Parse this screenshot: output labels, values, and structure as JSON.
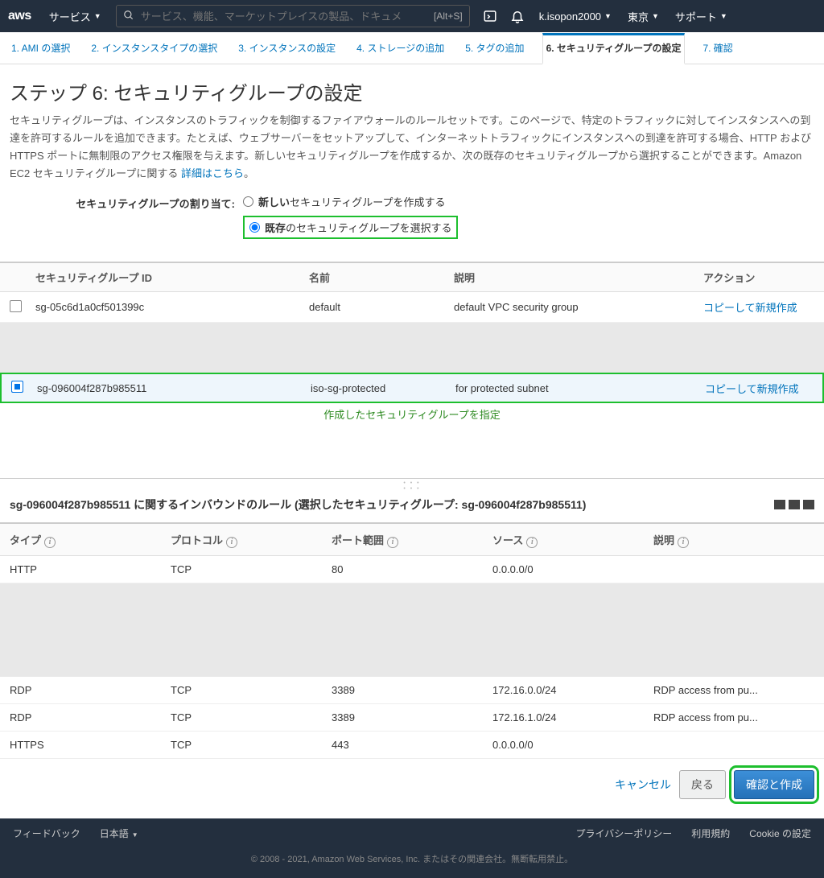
{
  "nav": {
    "services": "サービス",
    "search_placeholder": "サービス、機能、マーケットプレイスの製品、ドキュメ",
    "search_hint": "[Alt+S]",
    "user": "k.isopon2000",
    "region": "東京",
    "support": "サポート"
  },
  "wizard": {
    "tabs": [
      "1. AMI の選択",
      "2. インスタンスタイプの選択",
      "3. インスタンスの設定",
      "4. ストレージの追加",
      "5. タグの追加",
      "6. セキュリティグループの設定",
      "7. 確認"
    ]
  },
  "page": {
    "title": "ステップ 6: セキュリティグループの設定",
    "desc": "セキュリティグループは、インスタンスのトラフィックを制御するファイアウォールのルールセットです。このページで、特定のトラフィックに対してインスタンスへの到達を許可するルールを追加できます。たとえば、ウェブサーバーをセットアップして、インターネットトラフィックにインスタンスへの到達を許可する場合、HTTP および HTTPS ポートに無制限のアクセス権限を与えます。新しいセキュリティグループを作成するか、次の既存のセキュリティグループから選択することができます。Amazon EC2 セキュリティグループに関する ",
    "desc_link": "詳細はこちら",
    "assign_label": "セキュリティグループの割り当て:",
    "opt_new_bold": "新しい",
    "opt_new_rest": "セキュリティグループを作成する",
    "opt_exist_bold": "既存",
    "opt_exist_rest": "のセキュリティグループを選択する"
  },
  "sg_table": {
    "headers": {
      "id": "セキュリティグループ ID",
      "name": "名前",
      "desc": "説明",
      "action": "アクション"
    },
    "rows": [
      {
        "id": "sg-05c6d1a0cf501399c",
        "name": "default",
        "desc": "default VPC security group",
        "action": "コピーして新規作成",
        "checked": false
      },
      {
        "id": "sg-096004f287b985511",
        "name": "iso-sg-protected",
        "desc": "for protected subnet",
        "action": "コピーして新規作成",
        "checked": true
      }
    ],
    "annotation": "作成したセキュリティグループを指定"
  },
  "inbound": {
    "title_prefix": "sg-096004f287b985511 に関するインバウンドのルール (選択したセキュリティグループ: sg-096004f287b985511)",
    "headers": {
      "type": "タイプ",
      "proto": "プロトコル",
      "port": "ポート範囲",
      "src": "ソース",
      "desc": "説明"
    },
    "rows": [
      {
        "type": "HTTP",
        "proto": "TCP",
        "port": "80",
        "src": "0.0.0.0/0",
        "desc": ""
      },
      {
        "type": "RDP",
        "proto": "TCP",
        "port": "3389",
        "src": "172.16.0.0/24",
        "desc": "RDP access from pu..."
      },
      {
        "type": "RDP",
        "proto": "TCP",
        "port": "3389",
        "src": "172.16.1.0/24",
        "desc": "RDP access from pu..."
      },
      {
        "type": "HTTPS",
        "proto": "TCP",
        "port": "443",
        "src": "0.0.0.0/0",
        "desc": ""
      }
    ]
  },
  "actions": {
    "cancel": "キャンセル",
    "back": "戻る",
    "review": "確認と作成"
  },
  "footer": {
    "feedback": "フィードバック",
    "lang": "日本語",
    "privacy": "プライバシーポリシー",
    "terms": "利用規約",
    "cookie": "Cookie の設定",
    "copyright": "© 2008 - 2021, Amazon Web Services, Inc. またはその関連会社。無断転用禁止。"
  }
}
